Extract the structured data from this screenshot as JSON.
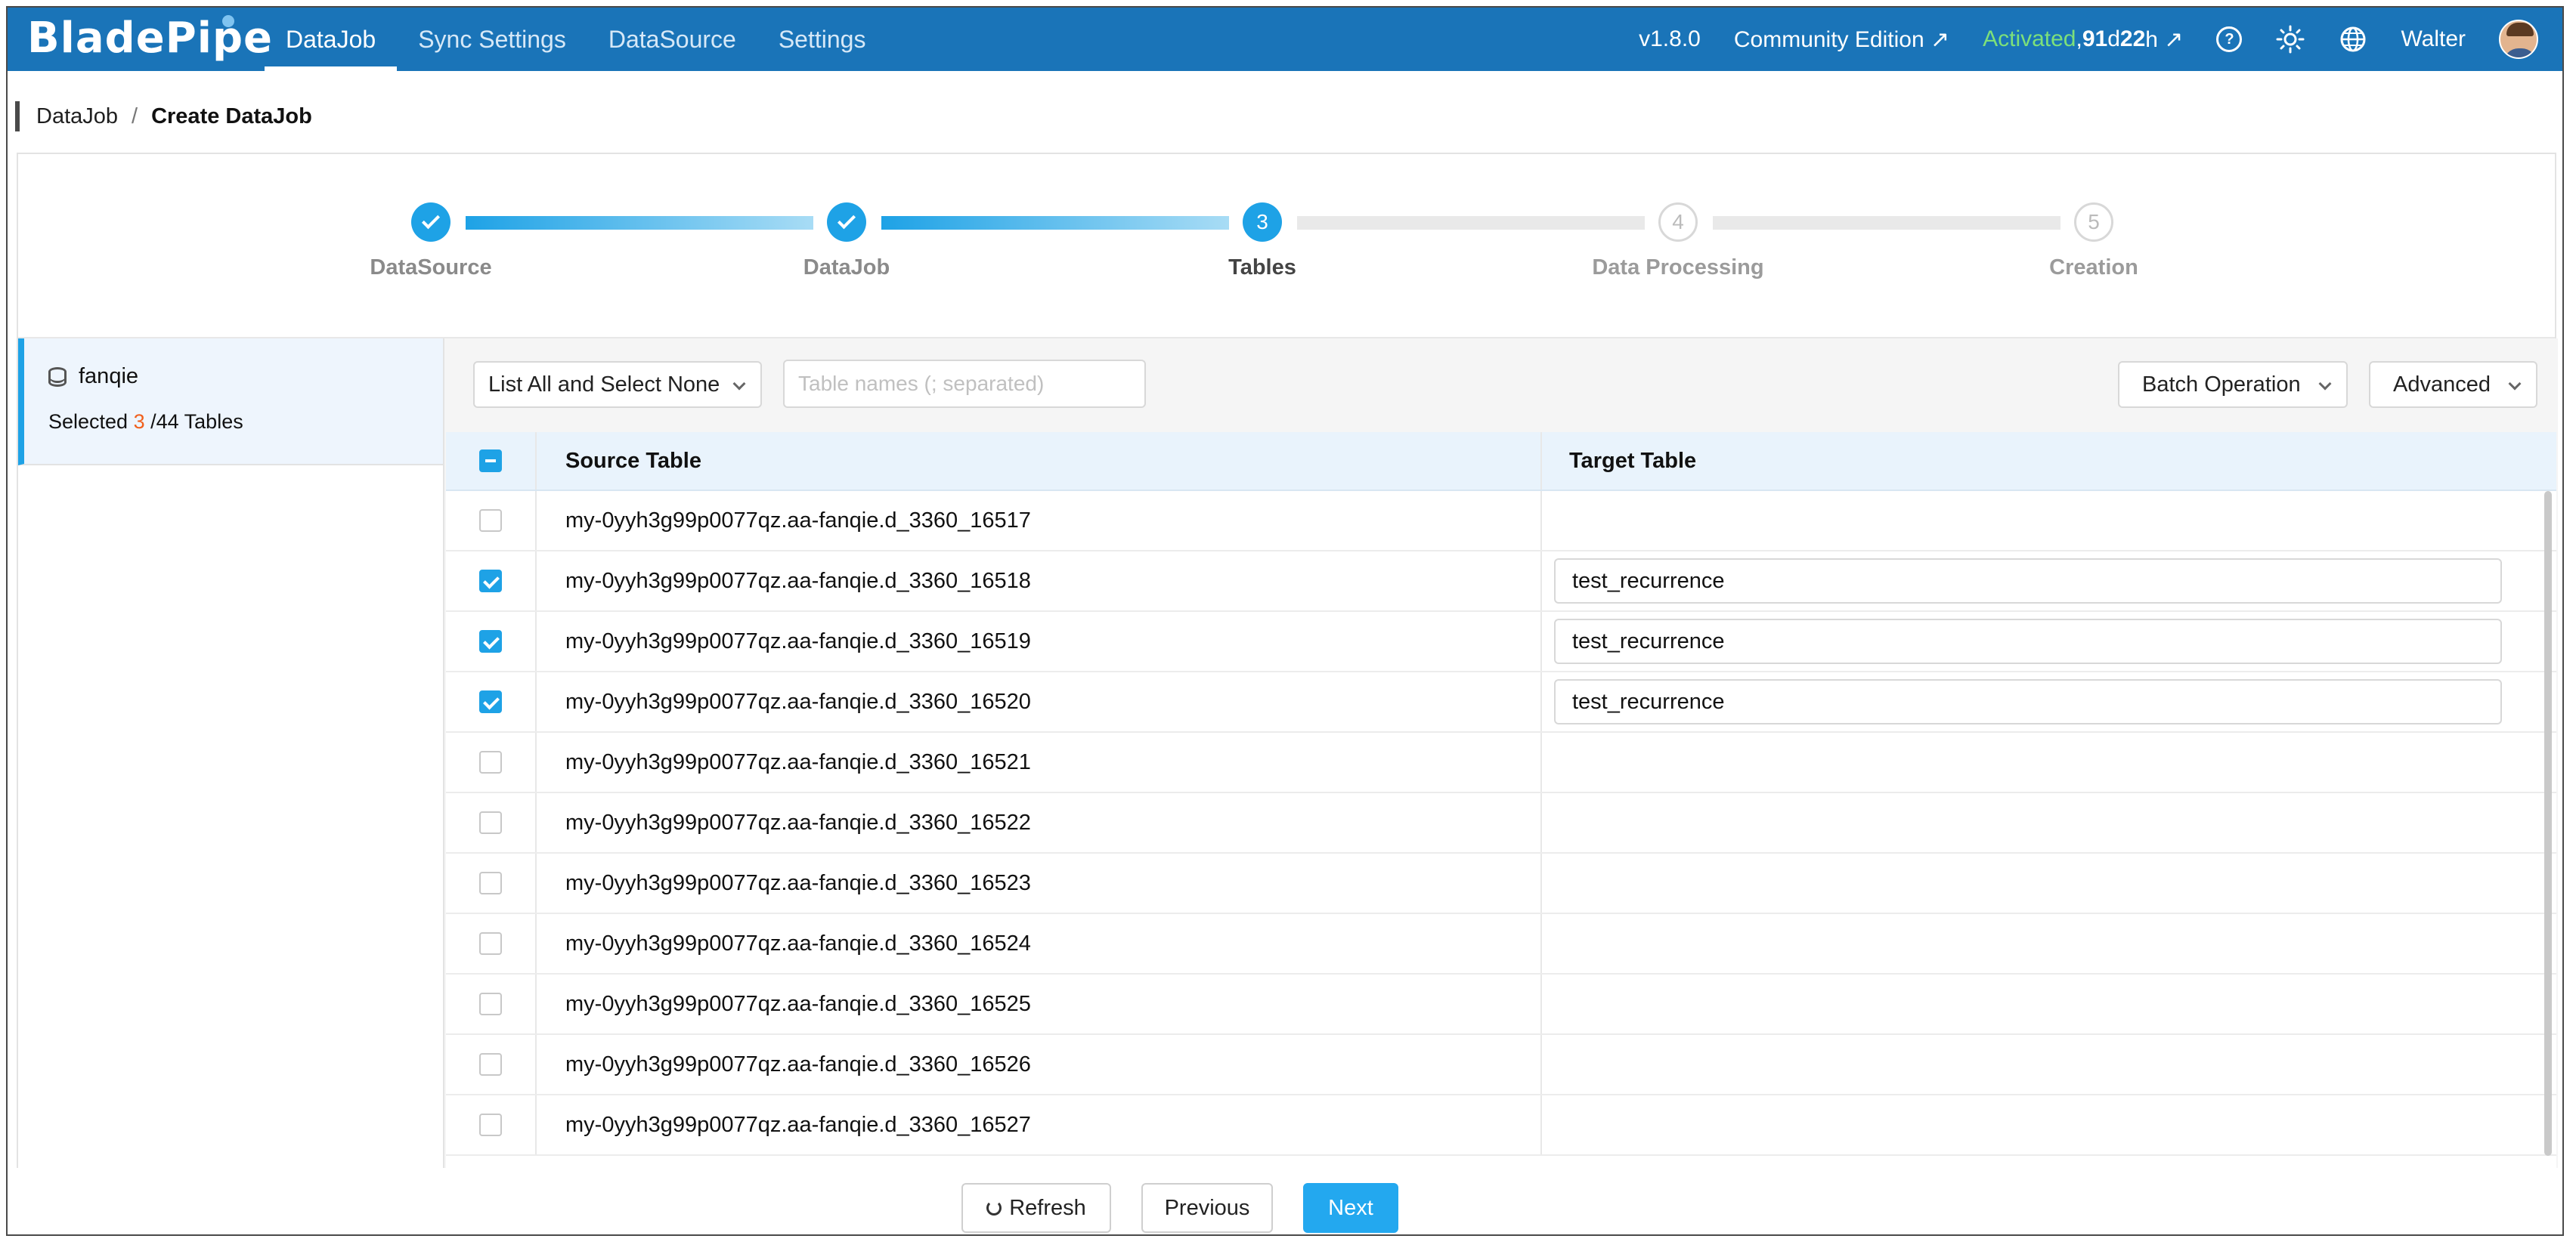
{
  "app": {
    "logo_text": "BladePipe"
  },
  "nav": {
    "items": [
      {
        "label": "DataJob",
        "active": true
      },
      {
        "label": "Sync Settings",
        "active": false
      },
      {
        "label": "DataSource",
        "active": false
      },
      {
        "label": "Settings",
        "active": false
      }
    ]
  },
  "header_right": {
    "version": "v1.8.0",
    "edition": "Community Edition ↗",
    "activated": "Activated",
    "license_prefix": ", ",
    "days": "91",
    "days_unit": " d ",
    "hours": "22",
    "hours_unit": " h ↗",
    "help_icon": "question-icon",
    "theme_icon": "sun-icon",
    "language_icon": "globe-icon",
    "user": "Walter"
  },
  "breadcrumb": {
    "root": "DataJob",
    "separator": "/",
    "current": "Create DataJob"
  },
  "steps": [
    {
      "label": "DataSource",
      "status": "done",
      "number": "1"
    },
    {
      "label": "DataJob",
      "status": "done",
      "number": "2"
    },
    {
      "label": "Tables",
      "status": "current",
      "number": "3"
    },
    {
      "label": "Data Processing",
      "status": "todo",
      "number": "4"
    },
    {
      "label": "Creation",
      "status": "todo",
      "number": "5"
    }
  ],
  "left_panel": {
    "db_name": "fanqie",
    "selected_prefix": "Selected ",
    "selected_count": "3",
    "selected_suffix": " /44 Tables"
  },
  "toolbar": {
    "select_value": "List All and Select None",
    "search_placeholder": "Table names (; separated)",
    "batch_label": "Batch Operation",
    "advanced_label": "Advanced"
  },
  "table": {
    "headers": {
      "source": "Source Table",
      "target": "Target Table"
    },
    "rows": [
      {
        "source": "my-0yyh3g99p0077qz.aa-fanqie.d_3360_16517",
        "checked": false,
        "target": ""
      },
      {
        "source": "my-0yyh3g99p0077qz.aa-fanqie.d_3360_16518",
        "checked": true,
        "target": "test_recurrence"
      },
      {
        "source": "my-0yyh3g99p0077qz.aa-fanqie.d_3360_16519",
        "checked": true,
        "target": "test_recurrence"
      },
      {
        "source": "my-0yyh3g99p0077qz.aa-fanqie.d_3360_16520",
        "checked": true,
        "target": "test_recurrence"
      },
      {
        "source": "my-0yyh3g99p0077qz.aa-fanqie.d_3360_16521",
        "checked": false,
        "target": ""
      },
      {
        "source": "my-0yyh3g99p0077qz.aa-fanqie.d_3360_16522",
        "checked": false,
        "target": ""
      },
      {
        "source": "my-0yyh3g99p0077qz.aa-fanqie.d_3360_16523",
        "checked": false,
        "target": ""
      },
      {
        "source": "my-0yyh3g99p0077qz.aa-fanqie.d_3360_16524",
        "checked": false,
        "target": ""
      },
      {
        "source": "my-0yyh3g99p0077qz.aa-fanqie.d_3360_16525",
        "checked": false,
        "target": ""
      },
      {
        "source": "my-0yyh3g99p0077qz.aa-fanqie.d_3360_16526",
        "checked": false,
        "target": ""
      },
      {
        "source": "my-0yyh3g99p0077qz.aa-fanqie.d_3360_16527",
        "checked": false,
        "target": ""
      }
    ]
  },
  "footer": {
    "refresh": "Refresh",
    "previous": "Previous",
    "next": "Next"
  },
  "colors": {
    "topbar": "#1a74b8",
    "primary": "#1ea2e6",
    "activated": "#7de07a",
    "selected_count": "#f0601e"
  }
}
